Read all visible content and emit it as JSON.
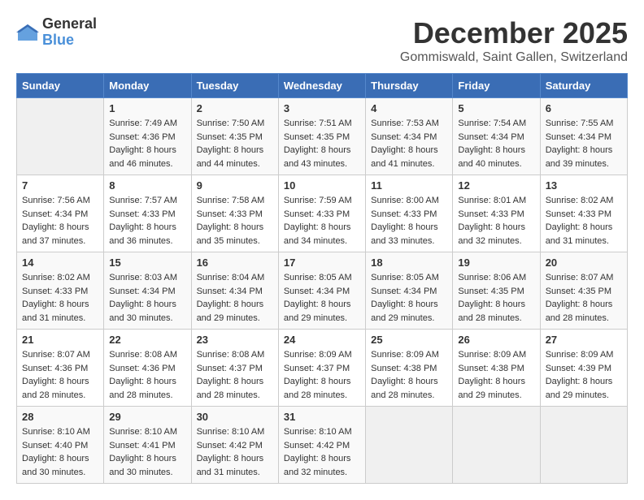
{
  "header": {
    "logo_general": "General",
    "logo_blue": "Blue",
    "month_year": "December 2025",
    "location": "Gommiswald, Saint Gallen, Switzerland"
  },
  "days_of_week": [
    "Sunday",
    "Monday",
    "Tuesday",
    "Wednesday",
    "Thursday",
    "Friday",
    "Saturday"
  ],
  "weeks": [
    [
      {
        "day": "",
        "empty": true
      },
      {
        "day": "1",
        "sunrise": "Sunrise: 7:49 AM",
        "sunset": "Sunset: 4:36 PM",
        "daylight": "Daylight: 8 hours and 46 minutes."
      },
      {
        "day": "2",
        "sunrise": "Sunrise: 7:50 AM",
        "sunset": "Sunset: 4:35 PM",
        "daylight": "Daylight: 8 hours and 44 minutes."
      },
      {
        "day": "3",
        "sunrise": "Sunrise: 7:51 AM",
        "sunset": "Sunset: 4:35 PM",
        "daylight": "Daylight: 8 hours and 43 minutes."
      },
      {
        "day": "4",
        "sunrise": "Sunrise: 7:53 AM",
        "sunset": "Sunset: 4:34 PM",
        "daylight": "Daylight: 8 hours and 41 minutes."
      },
      {
        "day": "5",
        "sunrise": "Sunrise: 7:54 AM",
        "sunset": "Sunset: 4:34 PM",
        "daylight": "Daylight: 8 hours and 40 minutes."
      },
      {
        "day": "6",
        "sunrise": "Sunrise: 7:55 AM",
        "sunset": "Sunset: 4:34 PM",
        "daylight": "Daylight: 8 hours and 39 minutes."
      }
    ],
    [
      {
        "day": "7",
        "sunrise": "Sunrise: 7:56 AM",
        "sunset": "Sunset: 4:34 PM",
        "daylight": "Daylight: 8 hours and 37 minutes."
      },
      {
        "day": "8",
        "sunrise": "Sunrise: 7:57 AM",
        "sunset": "Sunset: 4:33 PM",
        "daylight": "Daylight: 8 hours and 36 minutes."
      },
      {
        "day": "9",
        "sunrise": "Sunrise: 7:58 AM",
        "sunset": "Sunset: 4:33 PM",
        "daylight": "Daylight: 8 hours and 35 minutes."
      },
      {
        "day": "10",
        "sunrise": "Sunrise: 7:59 AM",
        "sunset": "Sunset: 4:33 PM",
        "daylight": "Daylight: 8 hours and 34 minutes."
      },
      {
        "day": "11",
        "sunrise": "Sunrise: 8:00 AM",
        "sunset": "Sunset: 4:33 PM",
        "daylight": "Daylight: 8 hours and 33 minutes."
      },
      {
        "day": "12",
        "sunrise": "Sunrise: 8:01 AM",
        "sunset": "Sunset: 4:33 PM",
        "daylight": "Daylight: 8 hours and 32 minutes."
      },
      {
        "day": "13",
        "sunrise": "Sunrise: 8:02 AM",
        "sunset": "Sunset: 4:33 PM",
        "daylight": "Daylight: 8 hours and 31 minutes."
      }
    ],
    [
      {
        "day": "14",
        "sunrise": "Sunrise: 8:02 AM",
        "sunset": "Sunset: 4:33 PM",
        "daylight": "Daylight: 8 hours and 31 minutes."
      },
      {
        "day": "15",
        "sunrise": "Sunrise: 8:03 AM",
        "sunset": "Sunset: 4:34 PM",
        "daylight": "Daylight: 8 hours and 30 minutes."
      },
      {
        "day": "16",
        "sunrise": "Sunrise: 8:04 AM",
        "sunset": "Sunset: 4:34 PM",
        "daylight": "Daylight: 8 hours and 29 minutes."
      },
      {
        "day": "17",
        "sunrise": "Sunrise: 8:05 AM",
        "sunset": "Sunset: 4:34 PM",
        "daylight": "Daylight: 8 hours and 29 minutes."
      },
      {
        "day": "18",
        "sunrise": "Sunrise: 8:05 AM",
        "sunset": "Sunset: 4:34 PM",
        "daylight": "Daylight: 8 hours and 29 minutes."
      },
      {
        "day": "19",
        "sunrise": "Sunrise: 8:06 AM",
        "sunset": "Sunset: 4:35 PM",
        "daylight": "Daylight: 8 hours and 28 minutes."
      },
      {
        "day": "20",
        "sunrise": "Sunrise: 8:07 AM",
        "sunset": "Sunset: 4:35 PM",
        "daylight": "Daylight: 8 hours and 28 minutes."
      }
    ],
    [
      {
        "day": "21",
        "sunrise": "Sunrise: 8:07 AM",
        "sunset": "Sunset: 4:36 PM",
        "daylight": "Daylight: 8 hours and 28 minutes."
      },
      {
        "day": "22",
        "sunrise": "Sunrise: 8:08 AM",
        "sunset": "Sunset: 4:36 PM",
        "daylight": "Daylight: 8 hours and 28 minutes."
      },
      {
        "day": "23",
        "sunrise": "Sunrise: 8:08 AM",
        "sunset": "Sunset: 4:37 PM",
        "daylight": "Daylight: 8 hours and 28 minutes."
      },
      {
        "day": "24",
        "sunrise": "Sunrise: 8:09 AM",
        "sunset": "Sunset: 4:37 PM",
        "daylight": "Daylight: 8 hours and 28 minutes."
      },
      {
        "day": "25",
        "sunrise": "Sunrise: 8:09 AM",
        "sunset": "Sunset: 4:38 PM",
        "daylight": "Daylight: 8 hours and 28 minutes."
      },
      {
        "day": "26",
        "sunrise": "Sunrise: 8:09 AM",
        "sunset": "Sunset: 4:38 PM",
        "daylight": "Daylight: 8 hours and 29 minutes."
      },
      {
        "day": "27",
        "sunrise": "Sunrise: 8:09 AM",
        "sunset": "Sunset: 4:39 PM",
        "daylight": "Daylight: 8 hours and 29 minutes."
      }
    ],
    [
      {
        "day": "28",
        "sunrise": "Sunrise: 8:10 AM",
        "sunset": "Sunset: 4:40 PM",
        "daylight": "Daylight: 8 hours and 30 minutes."
      },
      {
        "day": "29",
        "sunrise": "Sunrise: 8:10 AM",
        "sunset": "Sunset: 4:41 PM",
        "daylight": "Daylight: 8 hours and 30 minutes."
      },
      {
        "day": "30",
        "sunrise": "Sunrise: 8:10 AM",
        "sunset": "Sunset: 4:42 PM",
        "daylight": "Daylight: 8 hours and 31 minutes."
      },
      {
        "day": "31",
        "sunrise": "Sunrise: 8:10 AM",
        "sunset": "Sunset: 4:42 PM",
        "daylight": "Daylight: 8 hours and 32 minutes."
      },
      {
        "day": "",
        "empty": true
      },
      {
        "day": "",
        "empty": true
      },
      {
        "day": "",
        "empty": true
      }
    ]
  ]
}
